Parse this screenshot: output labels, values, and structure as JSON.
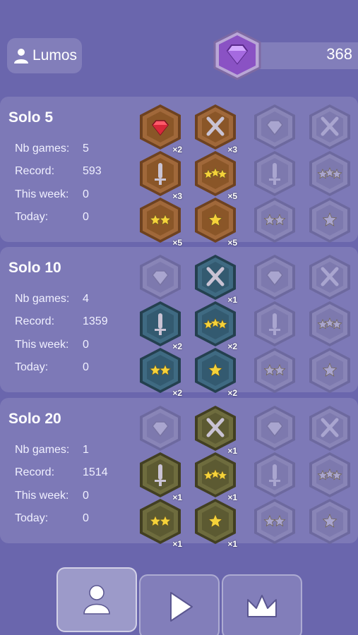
{
  "header": {
    "username": "Lumos",
    "gems": "368"
  },
  "stat_labels": [
    "Nb games:",
    "Record:",
    "This week:",
    "Today:"
  ],
  "panels": [
    {
      "title": "Solo 5",
      "theme": "bronze",
      "stats": [
        "5",
        "593",
        "0",
        "0"
      ],
      "badges": [
        {
          "icon": "gem",
          "earned": true,
          "mult": "×2"
        },
        {
          "icon": "swords",
          "earned": true,
          "mult": "×3"
        },
        {
          "icon": "gem",
          "earned": false,
          "mult": ""
        },
        {
          "icon": "swords",
          "earned": false,
          "mult": ""
        },
        {
          "icon": "sword",
          "earned": true,
          "mult": "×3"
        },
        {
          "icon": "three-stars",
          "earned": true,
          "mult": "×5"
        },
        {
          "icon": "sword",
          "earned": false,
          "mult": ""
        },
        {
          "icon": "three-stars",
          "earned": false,
          "mult": ""
        },
        {
          "icon": "two-stars",
          "earned": true,
          "mult": "×5"
        },
        {
          "icon": "one-star",
          "earned": true,
          "mult": "×5"
        },
        {
          "icon": "two-stars",
          "earned": false,
          "mult": ""
        },
        {
          "icon": "one-star",
          "earned": false,
          "mult": ""
        }
      ]
    },
    {
      "title": "Solo 10",
      "theme": "steel",
      "stats": [
        "4",
        "1359",
        "0",
        "0"
      ],
      "badges": [
        {
          "icon": "gem",
          "earned": false,
          "mult": ""
        },
        {
          "icon": "swords",
          "earned": true,
          "mult": "×1"
        },
        {
          "icon": "gem",
          "earned": false,
          "mult": ""
        },
        {
          "icon": "swords",
          "earned": false,
          "mult": ""
        },
        {
          "icon": "sword",
          "earned": true,
          "mult": "×2"
        },
        {
          "icon": "three-stars",
          "earned": true,
          "mult": "×2"
        },
        {
          "icon": "sword",
          "earned": false,
          "mult": ""
        },
        {
          "icon": "three-stars",
          "earned": false,
          "mult": ""
        },
        {
          "icon": "two-stars",
          "earned": true,
          "mult": "×2"
        },
        {
          "icon": "one-star",
          "earned": true,
          "mult": "×2"
        },
        {
          "icon": "two-stars",
          "earned": false,
          "mult": ""
        },
        {
          "icon": "one-star",
          "earned": false,
          "mult": ""
        }
      ]
    },
    {
      "title": "Solo 20",
      "theme": "olive",
      "stats": [
        "1",
        "1514",
        "0",
        "0"
      ],
      "badges": [
        {
          "icon": "gem",
          "earned": false,
          "mult": ""
        },
        {
          "icon": "swords",
          "earned": true,
          "mult": "×1"
        },
        {
          "icon": "gem",
          "earned": false,
          "mult": ""
        },
        {
          "icon": "swords",
          "earned": false,
          "mult": ""
        },
        {
          "icon": "sword",
          "earned": true,
          "mult": "×1"
        },
        {
          "icon": "three-stars",
          "earned": true,
          "mult": "×1"
        },
        {
          "icon": "sword",
          "earned": false,
          "mult": ""
        },
        {
          "icon": "three-stars",
          "earned": false,
          "mult": ""
        },
        {
          "icon": "two-stars",
          "earned": true,
          "mult": "×1"
        },
        {
          "icon": "one-star",
          "earned": true,
          "mult": "×1"
        },
        {
          "icon": "two-stars",
          "earned": false,
          "mult": ""
        },
        {
          "icon": "one-star",
          "earned": false,
          "mult": ""
        }
      ]
    }
  ],
  "tabs": [
    {
      "icon": "profile-icon",
      "active": true
    },
    {
      "icon": "play-icon",
      "active": false
    },
    {
      "icon": "crown-icon",
      "active": false
    }
  ],
  "colors": {
    "background": "#6a66ad",
    "bronze": "#a0683a",
    "steel": "#3f6a82",
    "olive": "#6e6c3e",
    "locked": "#8c88b8",
    "gem_purple": "#9b5fd6",
    "gem_red": "#d8283a",
    "star_yellow": "#f5d23a"
  }
}
